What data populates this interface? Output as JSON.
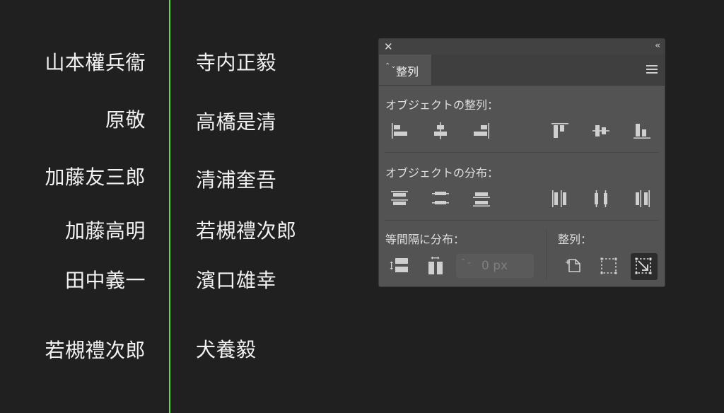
{
  "left_names": [
    "山本權兵衞",
    "原敬",
    "加藤友三郎",
    "加藤高明",
    "田中義一",
    "若槻禮次郎"
  ],
  "right_names": [
    "寺内正毅",
    "高橋是清",
    "清浦奎吾",
    "若槻禮次郎",
    "濱口雄幸",
    "犬養毅"
  ],
  "panel": {
    "close_glyph": "✕",
    "collapse_glyph": "‹‹",
    "tab_label": "整列",
    "tab_arrows": "⌃⌄",
    "align_objects_label": "オブジェクトの整列：",
    "distribute_objects_label": "オブジェクトの分布：",
    "distribute_spacing_label": "等間隔に分布：",
    "align_to_label": "整列：",
    "spacing_value": "0 px"
  },
  "colors": {
    "guide": "#5fdc3c",
    "background": "#202020",
    "panel_bg": "#535353"
  }
}
